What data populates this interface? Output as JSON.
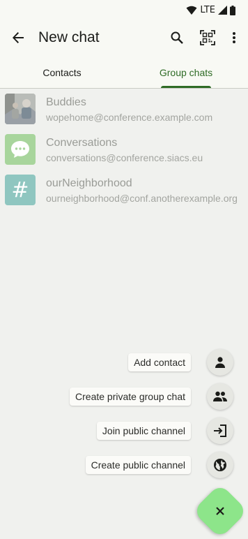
{
  "status": {
    "network": "LTE"
  },
  "appbar": {
    "title": "New chat",
    "back_icon": "arrow-back-icon",
    "search_icon": "search-icon",
    "qr_icon": "qr-code-scanner-icon",
    "more_icon": "more-vert-icon"
  },
  "tabs": [
    {
      "label": "Contacts",
      "selected": false
    },
    {
      "label": "Group chats",
      "selected": true
    }
  ],
  "accent_color": "#2e6b25",
  "groups": [
    {
      "name": "Buddies",
      "address": "wopehome@conference.example.com",
      "avatar": "photo"
    },
    {
      "name": "Conversations",
      "address": "conversations@conference.siacs.eu",
      "avatar": "chat-bubble-icon",
      "avatar_color": "#a8d59c"
    },
    {
      "name": "ourNeighborhood",
      "address": "ourneighborhood@conf.anotherexample.org",
      "avatar_letter": "#",
      "avatar_color": "#8fc6c0"
    }
  ],
  "speed_dial": [
    {
      "label": "Add contact",
      "icon": "person-icon"
    },
    {
      "label": "Create private group chat",
      "icon": "group-icon"
    },
    {
      "label": "Join public channel",
      "icon": "login-icon"
    },
    {
      "label": "Create public channel",
      "icon": "globe-icon"
    }
  ],
  "main_fab": {
    "icon": "close-icon",
    "color": "#8de58a"
  }
}
